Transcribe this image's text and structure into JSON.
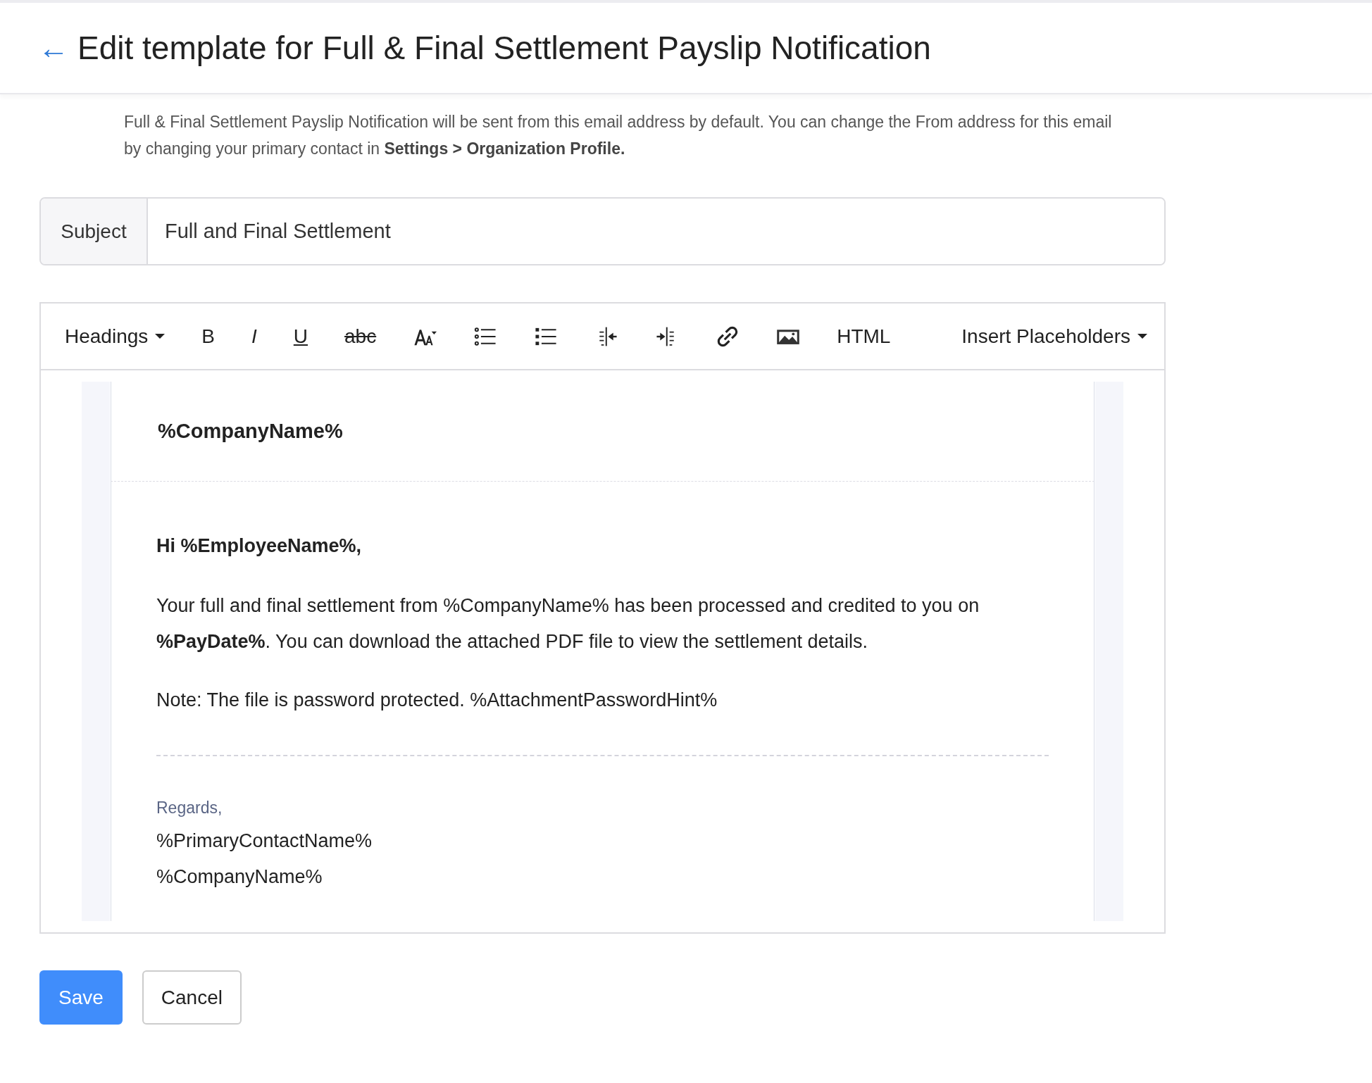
{
  "header": {
    "back_arrow": "←",
    "title": "Edit template for Full & Final Settlement Payslip Notification"
  },
  "info": {
    "text": "Full & Final Settlement Payslip Notification will be sent from this email address by default. You can change the From address for this email by changing your primary contact in **Settings > Organization Profile.**"
  },
  "subject": {
    "label": "Subject",
    "value": "Full and Final Settlement"
  },
  "toolbar": [
    {
      "kind": "dropdown",
      "label": "Headings"
    },
    {
      "kind": "bold",
      "label": "B"
    },
    {
      "kind": "italic",
      "label": "I"
    },
    {
      "kind": "underline",
      "label": "U"
    },
    {
      "kind": "strike",
      "label": "abc"
    },
    {
      "kind": "fontsize"
    },
    {
      "kind": "bullets"
    },
    {
      "kind": "list"
    },
    {
      "kind": "outdent"
    },
    {
      "kind": "indent"
    },
    {
      "kind": "link"
    },
    {
      "kind": "image"
    },
    {
      "kind": "html",
      "label": "HTML"
    },
    {
      "kind": "dropdown",
      "label": "Insert Placeholders"
    }
  ],
  "email": {
    "company": "%CompanyName%",
    "greeting": "Hi %EmployeeName%,",
    "paragraphs": [
      "Your full and final settlement from %CompanyName% has been processed and credited to you on **%PayDate%**. You can download the attached PDF file to view the settlement details.",
      "Note: The file is password protected. %AttachmentPasswordHint%"
    ],
    "regards": "Regards,",
    "signature": [
      "%PrimaryContactName%",
      "%CompanyName%"
    ]
  },
  "buttons": [
    {
      "label": "Save",
      "primary": true
    },
    {
      "label": "Cancel",
      "primary": false
    }
  ]
}
